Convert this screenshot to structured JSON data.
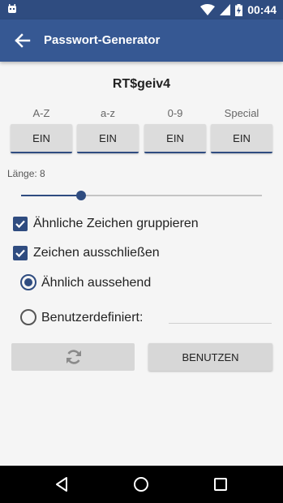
{
  "status_bar": {
    "time": "00:44",
    "icons": [
      "android-icon",
      "wifi-icon",
      "signal-icon",
      "battery-charging-icon"
    ]
  },
  "app_bar": {
    "title": "Passwort-Generator",
    "back_icon": "arrow-left-icon"
  },
  "password": "RT$geiv4",
  "character_sets": [
    {
      "label": "A-Z",
      "button": "EIN"
    },
    {
      "label": "a-z",
      "button": "EIN"
    },
    {
      "label": "0-9",
      "button": "EIN"
    },
    {
      "label": "Special",
      "button": "EIN"
    }
  ],
  "length": {
    "label": "Länge: 8",
    "value": 8,
    "slider_fraction": 0.25
  },
  "options": {
    "group_similar": {
      "label": "Ähnliche Zeichen gruppieren",
      "checked": true
    },
    "exclude_chars": {
      "label": "Zeichen ausschließen",
      "checked": true
    }
  },
  "exclude_modes": {
    "similar": {
      "label": "Ähnlich aussehend",
      "selected": true
    },
    "custom": {
      "label": "Benutzerdefiniert:",
      "selected": false,
      "value": ""
    }
  },
  "actions": {
    "refresh_icon": "refresh-icon",
    "use_label": "BENUTZEN"
  },
  "nav": [
    "back-triangle-icon",
    "home-circle-icon",
    "recents-square-icon"
  ],
  "colors": {
    "primary": "#365893",
    "status_bar": "#2f4c80",
    "accent": "#2f4c80",
    "background": "#f5f5f5"
  }
}
